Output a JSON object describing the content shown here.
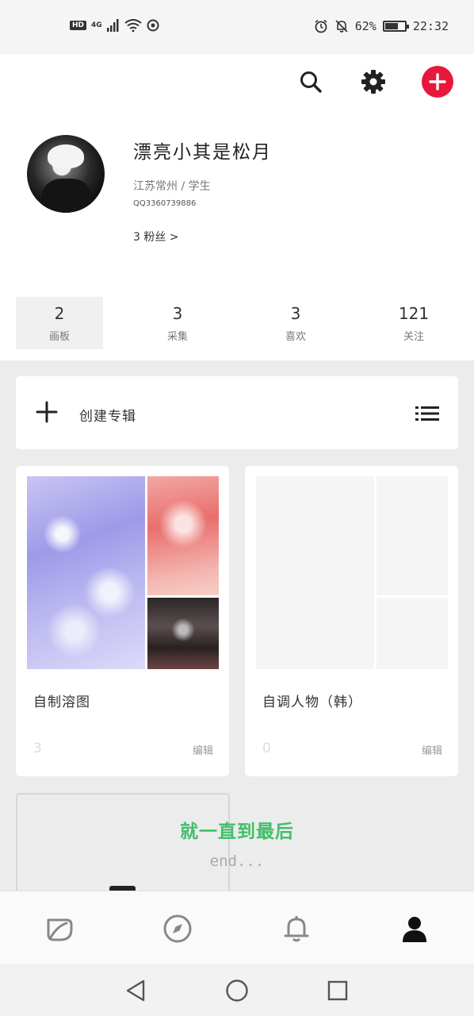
{
  "status_bar": {
    "hd": "HD",
    "network": "4G",
    "battery": "62%",
    "battery_level": 0.62,
    "time": "22:32"
  },
  "header": {
    "name": "漂亮小其是松月",
    "location": "江苏常州 / 学生",
    "qq": "QQ3360739886",
    "fans": "3 粉丝 >"
  },
  "stats": [
    {
      "num": "2",
      "label": "画板"
    },
    {
      "num": "3",
      "label": "采集"
    },
    {
      "num": "3",
      "label": "喜欢"
    },
    {
      "num": "121",
      "label": "关注"
    }
  ],
  "create": {
    "label": "创建专辑"
  },
  "albums": [
    {
      "title": "自制溶图",
      "count": "3",
      "edit": "编辑"
    },
    {
      "title": "自调人物（韩）",
      "count": "0",
      "edit": "编辑"
    }
  ],
  "overlay": {
    "line1": "就一直到最后",
    "line2": "end..."
  },
  "colors": {
    "accent": "#e8173c",
    "overlay_green": "#3fbf6a"
  },
  "icons": {
    "tabs": [
      "leaf-icon",
      "compass-icon",
      "bell-icon",
      "person-icon"
    ],
    "nav": [
      "back-triangle-icon",
      "home-circle-icon",
      "recents-square-icon"
    ]
  }
}
